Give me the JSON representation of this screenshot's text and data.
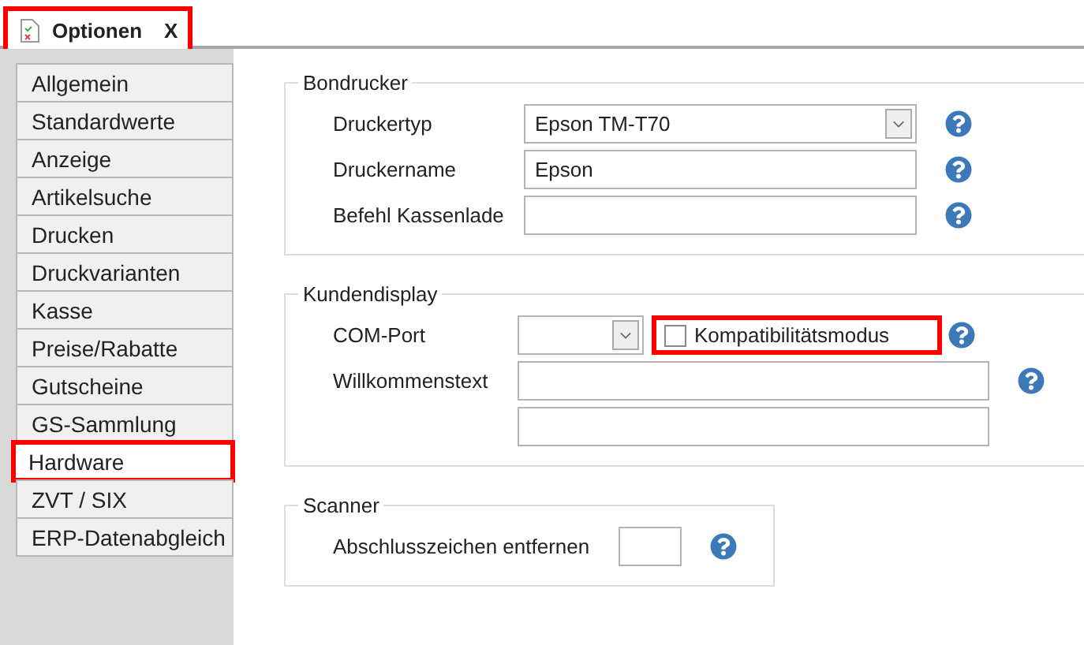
{
  "tab": {
    "label": "Optionen",
    "close": "X",
    "highlighted": true
  },
  "sidebar": {
    "items": [
      {
        "label": "Allgemein",
        "selected": false,
        "highlighted": false
      },
      {
        "label": "Standardwerte",
        "selected": false,
        "highlighted": false
      },
      {
        "label": "Anzeige",
        "selected": false,
        "highlighted": false
      },
      {
        "label": "Artikelsuche",
        "selected": false,
        "highlighted": false
      },
      {
        "label": "Drucken",
        "selected": false,
        "highlighted": false
      },
      {
        "label": "Druckvarianten",
        "selected": false,
        "highlighted": false
      },
      {
        "label": "Kasse",
        "selected": false,
        "highlighted": false
      },
      {
        "label": "Preise/Rabatte",
        "selected": false,
        "highlighted": false
      },
      {
        "label": "Gutscheine",
        "selected": false,
        "highlighted": false
      },
      {
        "label": "GS-Sammlung",
        "selected": false,
        "highlighted": false
      },
      {
        "label": "Hardware",
        "selected": true,
        "highlighted": true
      },
      {
        "label": "ZVT / SIX",
        "selected": false,
        "highlighted": false
      },
      {
        "label": "ERP-Datenabgleich",
        "selected": false,
        "highlighted": false
      }
    ]
  },
  "groups": [
    {
      "title": "Bondrucker",
      "rows": [
        {
          "kind": "select",
          "label": "Druckertyp",
          "value": "Epson TM-T70",
          "help": true
        },
        {
          "kind": "text",
          "label": "Druckername",
          "value": "Epson",
          "help": true
        },
        {
          "kind": "text",
          "label": "Befehl Kassenlade",
          "help": true
        }
      ]
    },
    {
      "title": "Kundendisplay",
      "rows": [
        {
          "kind": "port",
          "label": "COM-Port",
          "checkbox": {
            "label": "Kompatibilitätsmodus",
            "checked": false,
            "highlighted": true
          },
          "help": true
        },
        {
          "kind": "text",
          "label": "Willkommenstext",
          "help": true
        },
        {
          "kind": "text",
          "help": false
        }
      ]
    },
    {
      "title": "Scanner",
      "rows": [
        {
          "kind": "short",
          "label": "Abschlusszeichen entfernen",
          "help": true
        }
      ]
    }
  ]
}
